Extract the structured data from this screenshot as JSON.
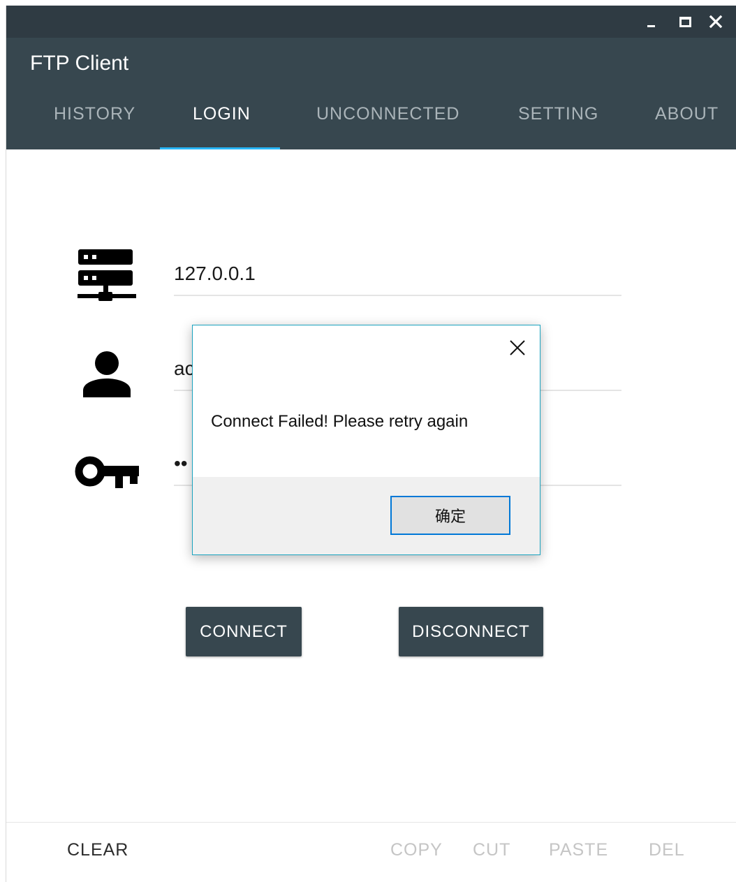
{
  "window": {
    "controls": [
      "minimize-icon",
      "maximize-icon",
      "close-icon"
    ]
  },
  "header": {
    "title": "FTP Client",
    "tabs": [
      {
        "label": "HISTORY",
        "active": false
      },
      {
        "label": "LOGIN",
        "active": true
      },
      {
        "label": "UNCONNECTED",
        "active": false
      },
      {
        "label": "SETTING",
        "active": false
      },
      {
        "label": "ABOUT",
        "active": false
      }
    ],
    "accent": "#29b6f6",
    "background": "#37474f"
  },
  "login": {
    "host": {
      "icon": "server-icon",
      "value": "127.0.0.1"
    },
    "user": {
      "icon": "user-icon",
      "value": "ac"
    },
    "password": {
      "icon": "key-icon",
      "value": "••"
    },
    "connect_label": "CONNECT",
    "disconnect_label": "DISCONNECT"
  },
  "bottom_bar": {
    "clear_label": "CLEAR",
    "copy_label": "COPY",
    "cut_label": "CUT",
    "paste_label": "PASTE",
    "del_label": "DEL"
  },
  "dialog": {
    "message": "Connect Failed! Please retry again",
    "ok_label": "确定",
    "close_icon": "close-icon",
    "border_color": "#1aa3bf"
  }
}
